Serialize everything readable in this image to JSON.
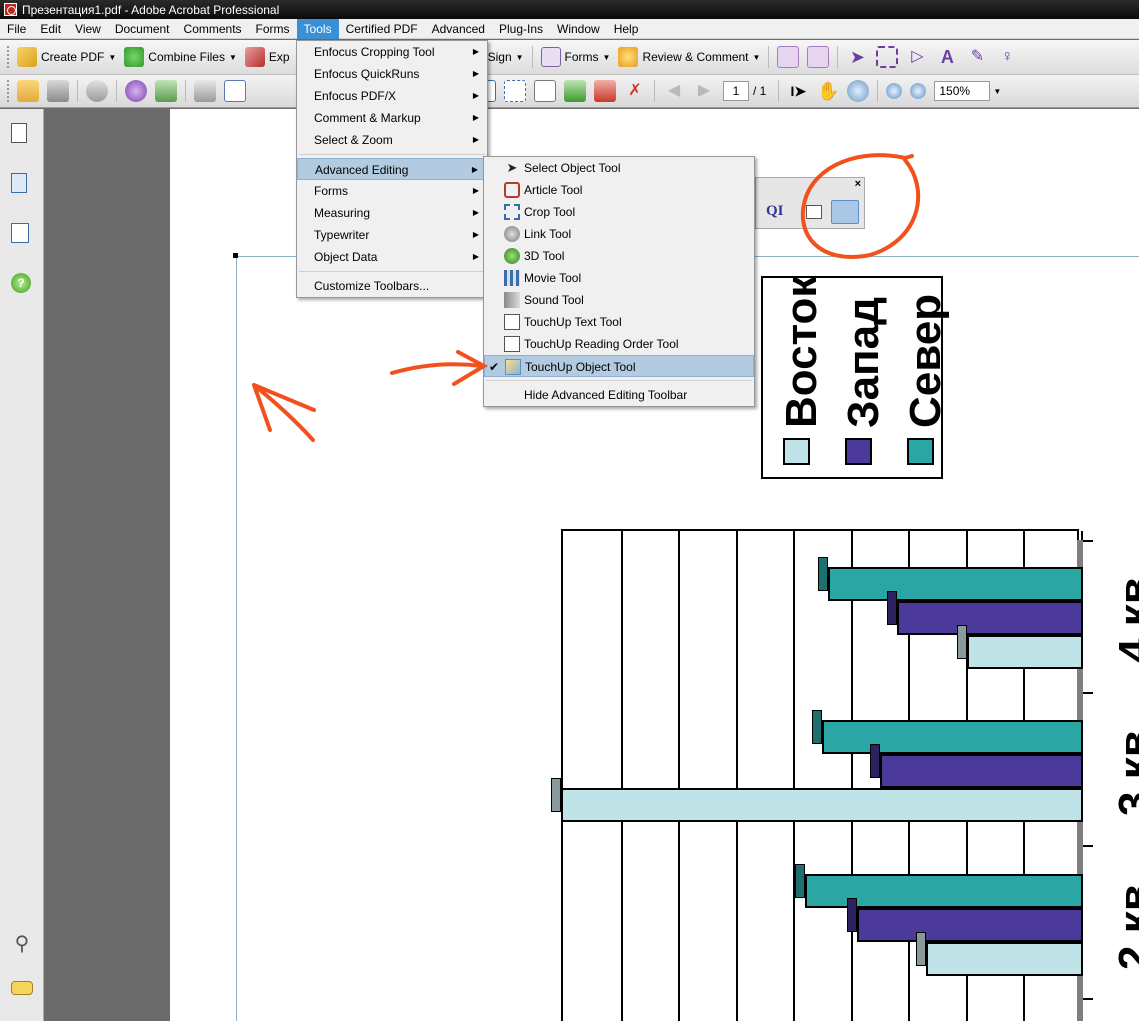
{
  "window": {
    "title": "Презентация1.pdf - Adobe Acrobat Professional"
  },
  "menubar": [
    "File",
    "Edit",
    "View",
    "Document",
    "Comments",
    "Forms",
    "Tools",
    "Certified PDF",
    "Advanced",
    "Plug-Ins",
    "Window",
    "Help"
  ],
  "menubar_active": "Tools",
  "toolbar1": {
    "create_pdf": "Create PDF",
    "combine_files": "Combine Files",
    "export_partial": "Exp",
    "sign_partial": "Sign",
    "forms": "Forms",
    "review_comment": "Review & Comment"
  },
  "toolbar2": {
    "page_current": "1",
    "page_total": "/ 1",
    "zoom": "150%"
  },
  "tools_menu": {
    "items": [
      {
        "label": "Enfocus Cropping Tool",
        "submenu": true
      },
      {
        "label": "Enfocus QuickRuns",
        "submenu": true
      },
      {
        "label": "Enfocus PDF/X",
        "submenu": true
      },
      {
        "label": "Comment & Markup",
        "submenu": true
      },
      {
        "label": "Select & Zoom",
        "submenu": true
      },
      {
        "label": "Advanced Editing",
        "submenu": true,
        "highlighted": true
      },
      {
        "label": "Forms",
        "submenu": true
      },
      {
        "label": "Measuring",
        "submenu": true
      },
      {
        "label": "Typewriter",
        "submenu": true
      },
      {
        "label": "Object Data",
        "submenu": true
      },
      {
        "label": "Customize Toolbars...",
        "submenu": false
      }
    ]
  },
  "advanced_editing_menu": {
    "items": [
      {
        "label": "Select Object Tool",
        "icon": "pointer-icon"
      },
      {
        "label": "Article Tool",
        "icon": "article-icon"
      },
      {
        "label": "Crop Tool",
        "icon": "crop-icon"
      },
      {
        "label": "Link Tool",
        "icon": "link-icon"
      },
      {
        "label": "3D Tool",
        "icon": "3d-icon"
      },
      {
        "label": "Movie Tool",
        "icon": "movie-icon"
      },
      {
        "label": "Sound Tool",
        "icon": "sound-icon"
      },
      {
        "label": "TouchUp Text Tool",
        "icon": "touchup-text-icon"
      },
      {
        "label": "TouchUp Reading Order Tool",
        "icon": "reading-order-icon"
      },
      {
        "label": "TouchUp Object Tool",
        "icon": "touchup-object-icon",
        "checked": true
      },
      {
        "label": "Hide Advanced Editing Toolbar",
        "icon": ""
      }
    ]
  },
  "floating_toolbar": {
    "ql_text": "QI",
    "close": "×"
  },
  "legend": {
    "entries": [
      {
        "name": "Восток",
        "color": "#bfe3e6"
      },
      {
        "name": "Запад",
        "color": "#4b3a9a"
      },
      {
        "name": "Север",
        "color": "#2aa6a5"
      }
    ]
  },
  "chart_data": {
    "type": "bar",
    "orientation": "rotated",
    "categories": [
      "4 кв",
      "3 кв",
      "2 кв"
    ],
    "series": [
      {
        "name": "Север",
        "values": [
          44,
          45,
          48
        ]
      },
      {
        "name": "Запад",
        "values": [
          32,
          35,
          39
        ]
      },
      {
        "name": "Восток",
        "values": [
          20,
          90,
          27
        ]
      }
    ],
    "grid": true,
    "legend_position": "top"
  },
  "colors": {
    "east": "#bfe3e6",
    "west": "#4b3a9a",
    "north": "#2aa6a5",
    "annotation": "#f2501c",
    "menu_highlight": "#b3cbe0"
  }
}
